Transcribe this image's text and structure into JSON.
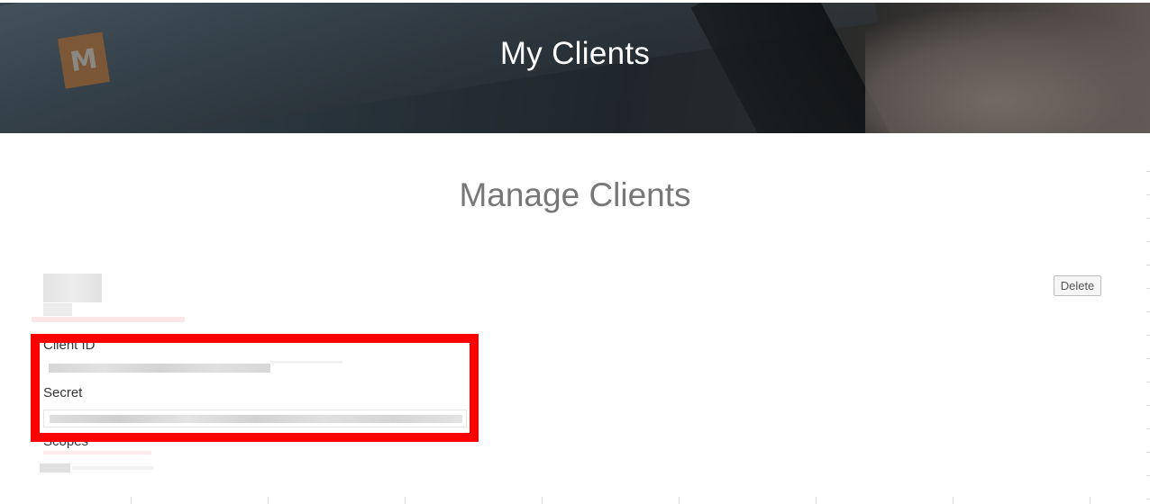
{
  "hero": {
    "title": "My Clients",
    "logo_letter": "M"
  },
  "section": {
    "heading": "Manage Clients"
  },
  "client": {
    "delete_label": "Delete",
    "client_id_label": "Client ID",
    "secret_label": "Secret",
    "scopes_label": "Scopes"
  },
  "colors": {
    "highlight": "#ff0000",
    "logo": "#d6833a"
  }
}
